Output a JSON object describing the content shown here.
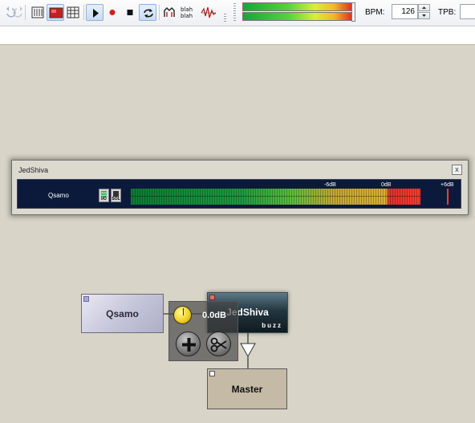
{
  "toolbar": {
    "bpm_label": "BPM:",
    "bpm_value": "126",
    "tpb_label": "TPB:",
    "tpb_value": "",
    "master_meter_level_left": 0.95,
    "master_meter_level_right": 0.95,
    "icons": [
      "undo-icon",
      "redo-icon",
      "pattern-editor-icon",
      "machine-view-icon",
      "sequence-editor-icon",
      "play-icon",
      "record-icon",
      "stop-icon",
      "loop-icon",
      "cpu-icon",
      "blah-blah-icon",
      "wave-icon"
    ]
  },
  "mixer": {
    "title": "JedShiva",
    "close_label": "x",
    "track_label": "Qsamo",
    "io_label": "I/O",
    "solo_label": "SOL",
    "db_marks": [
      "-6dB",
      "0dB",
      "+6dB"
    ]
  },
  "machines": {
    "qsamo": {
      "name": "Qsamo"
    },
    "jedshiva": {
      "name": "JedShiva",
      "subtitle": "buzz"
    },
    "master": {
      "name": "Master"
    }
  },
  "connection": {
    "gain_label": "0.0dB"
  },
  "colors": {
    "background": "#d8d4c7",
    "mixer_body": "#0b1a3a",
    "knob": "#f1d320"
  }
}
